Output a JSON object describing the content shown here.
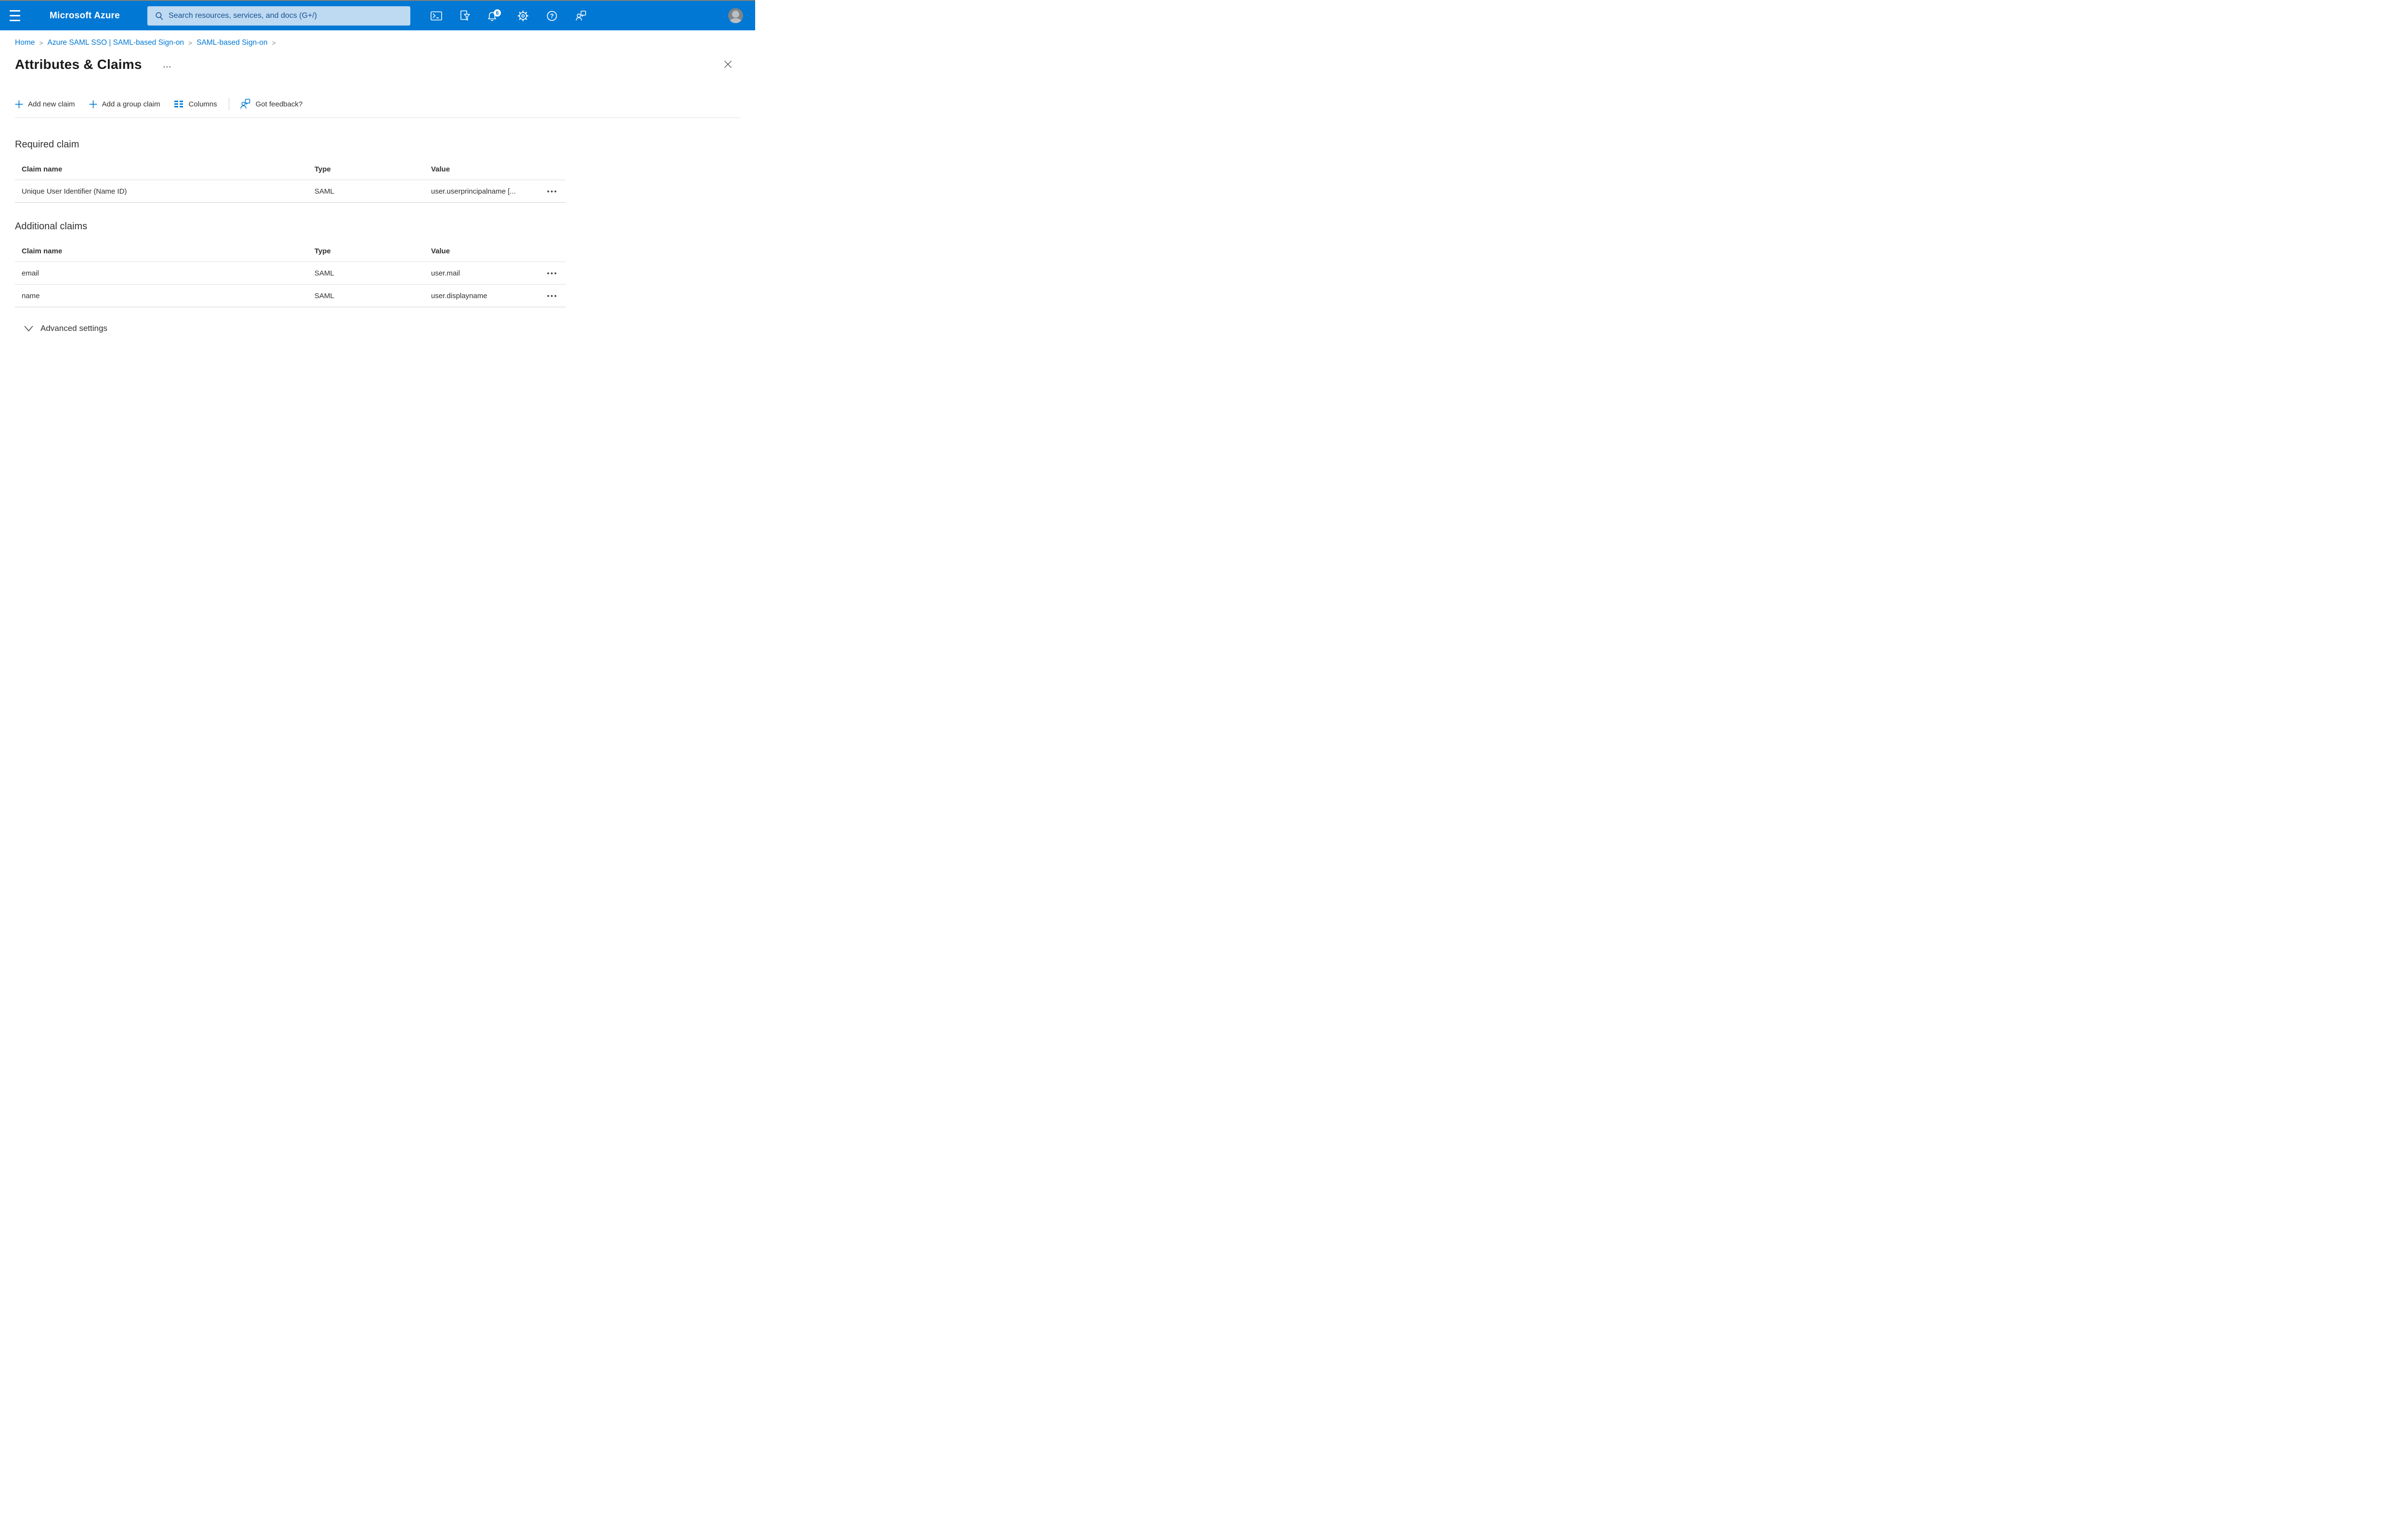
{
  "topbar": {
    "brand": "Microsoft Azure",
    "search": {
      "placeholder": "Search resources, services, and docs (G+/)"
    },
    "notifications_badge": "6",
    "icon_names": [
      "hamburger-menu-icon",
      "search-icon",
      "cloud-shell-icon",
      "directory-filter-icon",
      "notifications-bell-icon",
      "settings-gear-icon",
      "help-icon",
      "feedback-icon",
      "avatar"
    ]
  },
  "colors": {
    "topbar_blue": "#0078d4",
    "accent_blue": "#0078d4",
    "search_bg": "#bed9f2",
    "search_text": "#175290",
    "divider": "#e1dfdd",
    "text": "#323130"
  },
  "breadcrumb": {
    "separator": ">",
    "items": [
      "Home",
      "Azure SAML SSO | SAML-based Sign-on",
      "SAML-based Sign-on"
    ]
  },
  "page": {
    "title": "Attributes & Claims",
    "title_menu_glyph": "···"
  },
  "toolbar": {
    "add_new_claim": "Add new claim",
    "add_group_claim": "Add a group claim",
    "columns": "Columns",
    "got_feedback": "Got feedback?"
  },
  "tables_meta": {
    "row_menu_glyph": "•••"
  },
  "required_claim": {
    "heading": "Required claim",
    "columns": [
      "Claim name",
      "Type",
      "Value"
    ],
    "rows": [
      {
        "claim_name": "Unique User Identifier (Name ID)",
        "type": "SAML",
        "value": "user.userprincipalname [..."
      }
    ]
  },
  "additional_claims": {
    "heading": "Additional claims",
    "columns": [
      "Claim name",
      "Type",
      "Value"
    ],
    "rows": [
      {
        "claim_name": "email",
        "type": "SAML",
        "value": "user.mail"
      },
      {
        "claim_name": "name",
        "type": "SAML",
        "value": "user.displayname"
      }
    ]
  },
  "advanced": {
    "label": "Advanced settings"
  }
}
